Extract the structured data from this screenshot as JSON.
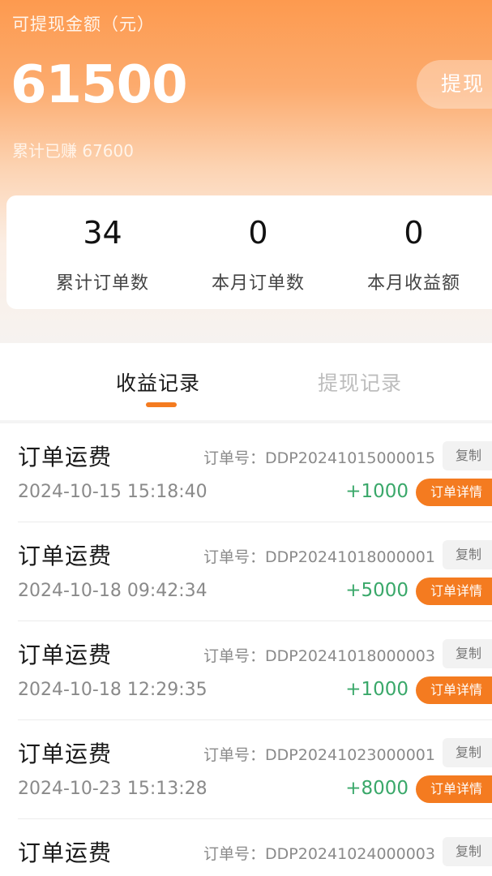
{
  "header": {
    "label": "可提现金额（元）",
    "balance": "61500",
    "withdraw_button": "提现",
    "total_earned": "累计已赚 67600"
  },
  "stats": [
    {
      "value": "34",
      "label": "累计订单数"
    },
    {
      "value": "0",
      "label": "本月订单数"
    },
    {
      "value": "0",
      "label": "本月收益额"
    }
  ],
  "tabs": {
    "income_records": "收益记录",
    "withdraw_records": "提现记录"
  },
  "records": [
    {
      "title": "订单运费",
      "order_prefix": "订单号：",
      "order_no": "DDP20241015000015",
      "copy": "复制",
      "time": "2024-10-15 15:18:40",
      "amount": "+1000",
      "detail": "订单详情"
    },
    {
      "title": "订单运费",
      "order_prefix": "订单号：",
      "order_no": "DDP20241018000001",
      "copy": "复制",
      "time": "2024-10-18 09:42:34",
      "amount": "+5000",
      "detail": "订单详情"
    },
    {
      "title": "订单运费",
      "order_prefix": "订单号：",
      "order_no": "DDP20241018000003",
      "copy": "复制",
      "time": "2024-10-18 12:29:35",
      "amount": "+1000",
      "detail": "订单详情"
    },
    {
      "title": "订单运费",
      "order_prefix": "订单号：",
      "order_no": "DDP20241023000001",
      "copy": "复制",
      "time": "2024-10-23 15:13:28",
      "amount": "+8000",
      "detail": "订单详情"
    },
    {
      "title": "订单运费",
      "order_prefix": "订单号：",
      "order_no": "DDP20241024000003",
      "copy": "复制",
      "time": "",
      "amount": "",
      "detail": ""
    }
  ],
  "colors": {
    "accent": "#f47b20",
    "income_green": "#3aa86a"
  }
}
